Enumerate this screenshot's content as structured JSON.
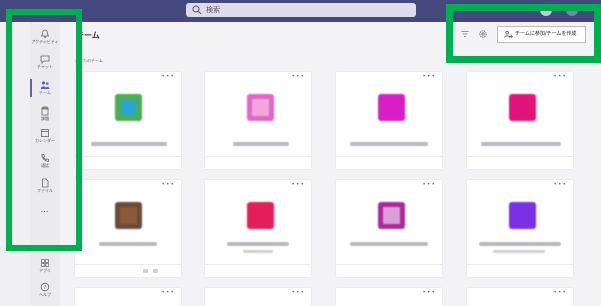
{
  "topbar": {
    "search_placeholder": "検索",
    "color": "#45487f"
  },
  "rail": {
    "items": [
      {
        "label": "アクティビティ",
        "icon": "bell-icon"
      },
      {
        "label": "チャット",
        "icon": "chat-icon"
      },
      {
        "label": "チーム",
        "icon": "teams-icon",
        "active": true
      },
      {
        "label": "課題",
        "icon": "assignments-icon"
      },
      {
        "label": "カレンダー",
        "icon": "calendar-icon"
      },
      {
        "label": "通話",
        "icon": "phone-icon"
      },
      {
        "label": "ファイル",
        "icon": "file-icon"
      }
    ],
    "more": "…",
    "bottom": [
      {
        "label": "アプリ",
        "icon": "apps-icon"
      },
      {
        "label": "ヘルプ",
        "icon": "help-icon"
      }
    ],
    "accent": "#5b5fc7"
  },
  "main": {
    "title": "チーム",
    "section_label": "あなたのチーム",
    "join_button_label": "チームに参加/チームを作成",
    "card_more": "•••",
    "cards": [
      {
        "color": "#4caf50",
        "inner": "#2aa3d6"
      },
      {
        "color": "#e066c8",
        "inner": "#f2a6d9"
      },
      {
        "color": "#d81ec4",
        "inner": "#d81ec4"
      },
      {
        "color": "#e0147a",
        "inner": "#e0147a"
      },
      {
        "color": "#6b4a3a",
        "inner": "#8a5a3a"
      },
      {
        "color": "#e41e5a",
        "inner": "#e41e5a"
      },
      {
        "color": "#b0279a",
        "inner": "#d8a0d8"
      },
      {
        "color": "#7a2ee6",
        "inner": "#7a2ee6"
      }
    ]
  },
  "highlight_color": "#00b050"
}
